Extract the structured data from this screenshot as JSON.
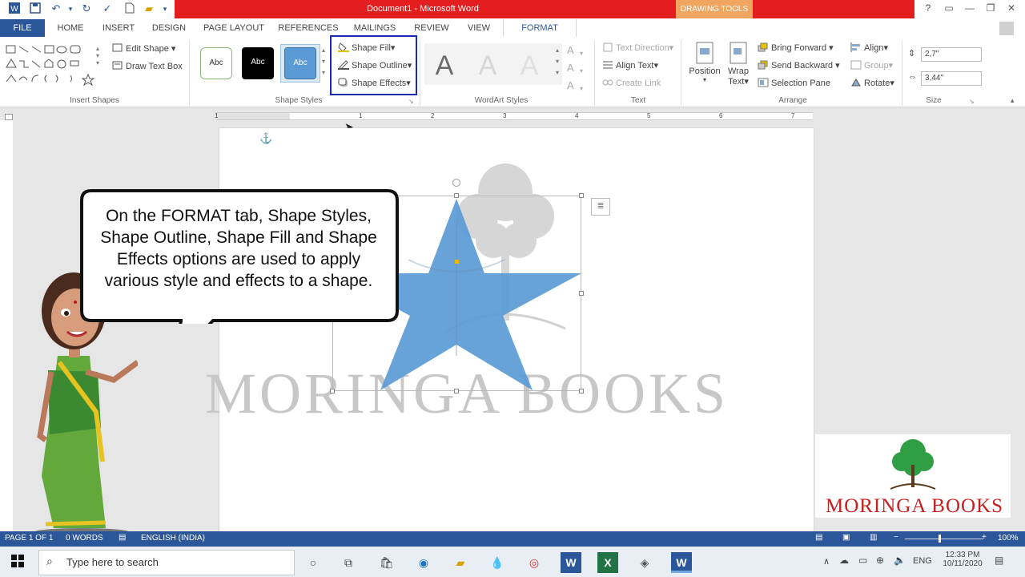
{
  "window": {
    "title": "Document1 -  Microsoft Word",
    "contextual_tab": "DRAWING TOOLS",
    "help": "?"
  },
  "tabs": [
    "FILE",
    "HOME",
    "INSERT",
    "DESIGN",
    "PAGE LAYOUT",
    "REFERENCES",
    "MAILINGS",
    "REVIEW",
    "VIEW",
    "FORMAT"
  ],
  "ribbon": {
    "insert_shapes": {
      "label": "Insert Shapes",
      "edit_shape": "Edit Shape",
      "draw_text_box": "Draw Text Box"
    },
    "shape_styles": {
      "label": "Shape Styles",
      "style_sample": "Abc",
      "shape_fill": "Shape Fill",
      "shape_outline": "Shape Outline",
      "shape_effects": "Shape Effects"
    },
    "wordart": {
      "label": "WordArt Styles",
      "sample": "A"
    },
    "text": {
      "label": "Text",
      "text_direction": "Text Direction",
      "align_text": "Align Text",
      "create_link": "Create Link"
    },
    "arrange": {
      "label": "Arrange",
      "position": "Position",
      "wrap_text_1": "Wrap",
      "wrap_text_2": "Text",
      "bring_forward": "Bring Forward",
      "send_backward": "Send Backward",
      "selection_pane": "Selection Pane",
      "align": "Align",
      "group": "Group",
      "rotate": "Rotate"
    },
    "size": {
      "label": "Size",
      "height": "2,7\"",
      "width": "3,44\""
    }
  },
  "ruler_numbers": [
    "1",
    "1",
    "2",
    "3",
    "4",
    "5",
    "6",
    "7"
  ],
  "callout": {
    "text": "On the FORMAT tab, Shape Styles, Shape Outline, Shape Fill and Shape Effects options are used to apply various style and effects to a shape."
  },
  "watermark": "MORINGA BOOKS",
  "logo": "MORINGA BOOKS",
  "colors": {
    "word_blue": "#2b579a",
    "title_red": "#e41e1e",
    "star_fill": "#5b9bd5",
    "highlight_border": "#1a2bb8"
  },
  "status": {
    "page": "PAGE 1 OF 1",
    "words": "0 WORDS",
    "language": "ENGLISH (INDIA)",
    "zoom": "100%"
  },
  "taskbar": {
    "search_placeholder": "Type here to search",
    "lang": "ENG",
    "time": "12:33 PM",
    "date": "10/11/2020"
  }
}
